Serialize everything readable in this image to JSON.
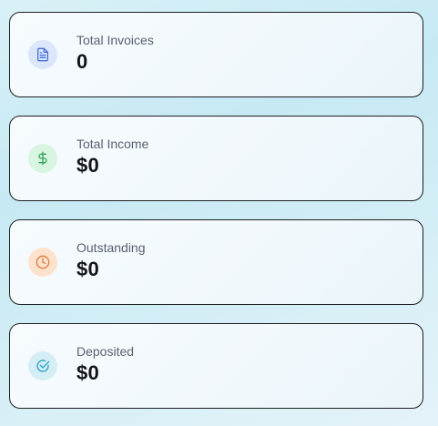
{
  "cards": [
    {
      "label": "Total Invoices",
      "value": "0",
      "icon": "document-icon",
      "icon_color": "#4a6fdc",
      "icon_bg": "#dbe6fb"
    },
    {
      "label": "Total Income",
      "value": "$0",
      "icon": "dollar-icon",
      "icon_color": "#2ea55a",
      "icon_bg": "#d8f5e1"
    },
    {
      "label": "Outstanding",
      "value": "$0",
      "icon": "clock-icon",
      "icon_color": "#e07a3c",
      "icon_bg": "#fde3cd"
    },
    {
      "label": "Deposited",
      "value": "$0",
      "icon": "check-circle-icon",
      "icon_color": "#2aa2c9",
      "icon_bg": "#d5eef6"
    }
  ]
}
